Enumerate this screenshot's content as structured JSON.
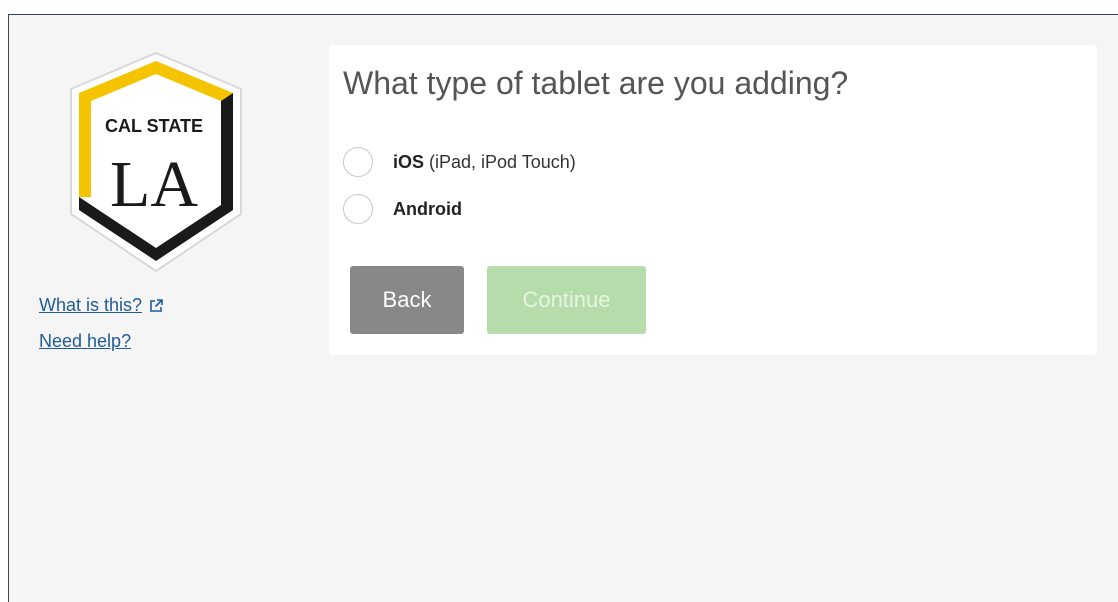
{
  "sidebar": {
    "logo": {
      "line1": "CAL STATE",
      "line2": "LA"
    },
    "what_link": "What is this?",
    "help_link": "Need help?"
  },
  "main": {
    "title": "What type of tablet are you adding?",
    "options": [
      {
        "bold": "iOS",
        "sub": "(iPad, iPod Touch)"
      },
      {
        "bold": "Android",
        "sub": ""
      }
    ],
    "back_label": "Back",
    "continue_label": "Continue"
  },
  "colors": {
    "logo_gold": "#f5c400",
    "logo_black": "#1a1a1a",
    "link": "#1f5c99",
    "back_button": "#888888",
    "continue_button_disabled": "#b5dcaa"
  },
  "icons": {
    "external_link": "external-link-icon",
    "logo": "cal-state-la-logo"
  }
}
